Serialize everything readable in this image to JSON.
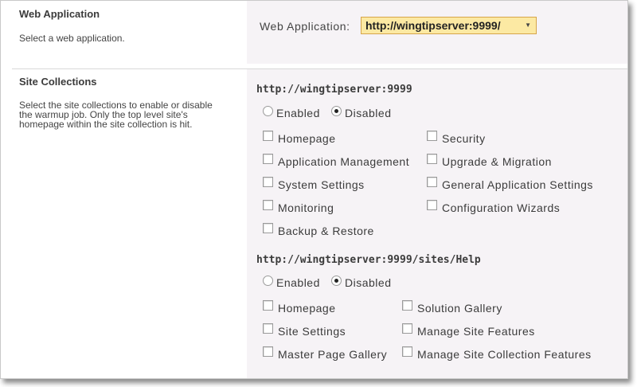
{
  "web_application": {
    "title": "Web Application",
    "description": "Select a web application.",
    "field_label": "Web Application:",
    "selected": "http://wingtipserver:9999/"
  },
  "site_collections": {
    "title": "Site Collections",
    "description": "Select the site collections to enable or disable the warmup job. Only the top level site's homepage within the site collection is hit.",
    "collections": [
      {
        "url": "http://wingtipserver:9999",
        "enabled_label": "Enabled",
        "disabled_label": "Disabled",
        "state": "disabled",
        "pages": [
          {
            "label": "Homepage",
            "checked": false
          },
          {
            "label": "Security",
            "checked": false
          },
          {
            "label": "Application Management",
            "checked": false
          },
          {
            "label": "Upgrade & Migration",
            "checked": false
          },
          {
            "label": "System Settings",
            "checked": false
          },
          {
            "label": "General Application Settings",
            "checked": false
          },
          {
            "label": "Monitoring",
            "checked": false
          },
          {
            "label": "Configuration Wizards",
            "checked": false
          },
          {
            "label": "Backup & Restore",
            "checked": false
          }
        ]
      },
      {
        "url": "http://wingtipserver:9999/sites/Help",
        "enabled_label": "Enabled",
        "disabled_label": "Disabled",
        "state": "disabled",
        "pages": [
          {
            "label": "Homepage",
            "checked": false
          },
          {
            "label": "Solution Gallery",
            "checked": false
          },
          {
            "label": "Site Settings",
            "checked": false
          },
          {
            "label": "Manage Site Features",
            "checked": false
          },
          {
            "label": "Master Page Gallery",
            "checked": false
          },
          {
            "label": "Manage Site Collection Features",
            "checked": false
          }
        ]
      }
    ]
  },
  "colors": {
    "right_panel_bg": "#f6f3f6",
    "dropdown_bg": "#fce9a3",
    "dropdown_border": "#d6a54a",
    "text": "#3b3b3b"
  },
  "icons": {
    "dropdown": "chevron-down-icon",
    "radio": "radio-icon",
    "checkbox": "checkbox-icon"
  }
}
